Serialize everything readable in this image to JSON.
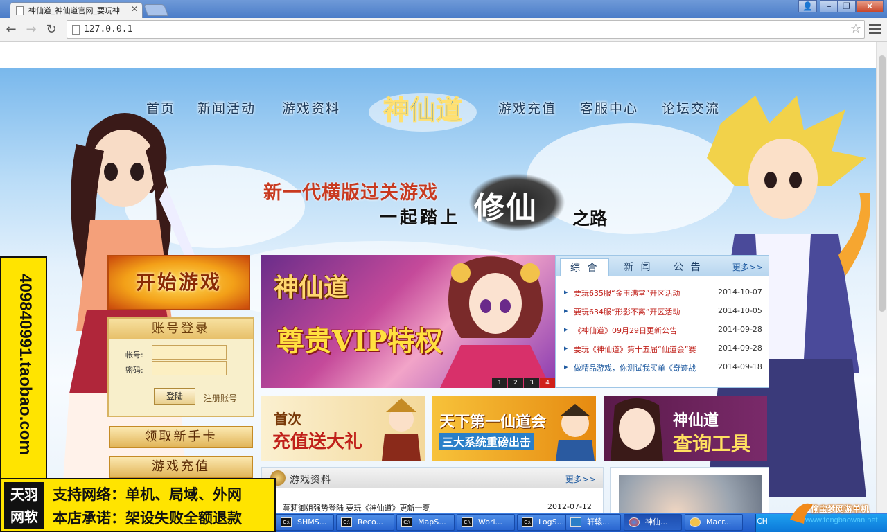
{
  "browser": {
    "tab_title": "神仙道_神仙道官网_要玩神",
    "url": "127.0.0.1"
  },
  "site": {
    "nav": [
      "首页",
      "新闻活动",
      "游戏资料",
      "游戏充值",
      "客服中心",
      "论坛交流"
    ],
    "logo_text": "神仙道",
    "slogan": {
      "line1": "新一代横版过关游戏",
      "line2": "一起踏上",
      "big": "修仙",
      "line3": "之路"
    },
    "start_button": "开始游戏",
    "login": {
      "title": "账号登录",
      "account_label": "帐号:",
      "password_label": "密码:",
      "submit": "登陆",
      "register": "注册账号"
    },
    "novice_card_button": "领取新手卡",
    "recharge_button": "游戏充值",
    "banner": {
      "logo": "神仙道",
      "text": "尊贵VIP特权",
      "pages": [
        "1",
        "2",
        "3",
        "4"
      ],
      "active_page": 4
    },
    "news": {
      "tabs": [
        "综 合",
        "新 闻",
        "公 告"
      ],
      "more": "更多>>",
      "items": [
        {
          "title": "要玩635服“金玉满堂”开区活动",
          "date": "2014-10-07",
          "color": "#c0201a"
        },
        {
          "title": "要玩634服“形影不离”开区活动",
          "date": "2014-10-05",
          "color": "#c0201a"
        },
        {
          "title": "《神仙道》09月29日更新公告",
          "date": "2014-09-28",
          "color": "#c0201a"
        },
        {
          "title": "要玩《神仙道》第十五届“仙道会”赛",
          "date": "2014-09-28",
          "color": "#c0201a"
        },
        {
          "title": "做精品游戏，你测试我买单《奇迹战",
          "date": "2014-09-18",
          "color": "#1e5aa0"
        }
      ]
    },
    "promos": [
      {
        "line1": "首次",
        "line2": "充值送大礼"
      },
      {
        "line1": "天下第一仙道会",
        "line2": "三大系统重磅出击"
      },
      {
        "line1": "神仙道",
        "line2": "查询工具"
      }
    ],
    "info": {
      "title": "游戏资料",
      "more": "更多>>",
      "row_text": "蔓莉御姐强势登陆 要玩《神仙道》更新一夏",
      "row_date": "2012-07-12"
    }
  },
  "overlay": {
    "vertical_text": "409840991.taobao.com",
    "logo_top": "天羽",
    "logo_bottom": "网软",
    "line1": "支持网络：单机、局域、外网",
    "line2": "本店承诺：架设失败全额退款"
  },
  "taskbar": {
    "items": [
      "SHMS...",
      "Reco...",
      "MapS...",
      "Worl...",
      "LogS...",
      "轩辕...",
      "神仙...",
      "Macr..."
    ],
    "active": 6,
    "lang": "CH",
    "watermark1": "偷宝梦网游单机",
    "watermark2": "www.tongbaowan.net"
  },
  "colors": {
    "accent_red": "#c0201a",
    "link_blue": "#1e5aa0",
    "overlay_yellow": "#ffe400",
    "gold": "#e2b65a"
  }
}
